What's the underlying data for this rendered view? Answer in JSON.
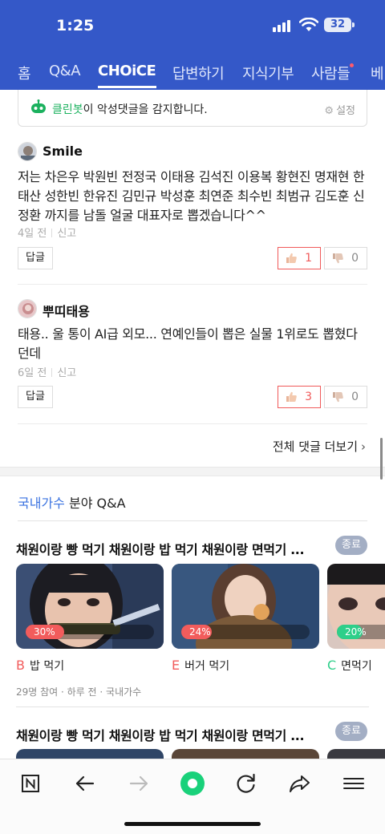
{
  "status_bar": {
    "time": "1:25",
    "battery": "32"
  },
  "nav": {
    "tabs": [
      {
        "label": "홈"
      },
      {
        "label": "Q&A"
      },
      {
        "label": "CHOiCE"
      },
      {
        "label": "답변하기"
      },
      {
        "label": "지식기부"
      },
      {
        "label": "사람들"
      },
      {
        "label": "베"
      }
    ],
    "active_tab": "CHOiCE"
  },
  "cleanbot": {
    "name": "클린봇",
    "message": "이 악성댓글을 감지합니다.",
    "settings_label": "설정"
  },
  "comments": [
    {
      "author": "Smile",
      "text": "저는 차은우 박원빈 전정국 이태용 김석진 이용복 황현진 명재현 한태산 성한빈 한유진 김민규 박성훈 최연준 최수빈 최범규 김도훈 신정환 까지를 남돌 얼굴 대표자로 뽑겠습니다^^",
      "time": "4일 전",
      "report": "신고",
      "reply_label": "답글",
      "likes": "1",
      "dislikes": "0"
    },
    {
      "author": "뿌띠태용",
      "text": "태용.. 울 통이 AI급 외모... 연예인들이 뽑은 실물 1위로도 뽑혔다던데",
      "time": "6일 전",
      "report": "신고",
      "reply_label": "답글",
      "likes": "3",
      "dislikes": "0"
    }
  ],
  "more_comments": "전체 댓글 더보기",
  "section": {
    "category": "국내가수",
    "suffix": " 분야 Q&A"
  },
  "qa_items": [
    {
      "title": "채원이랑 빵 먹기 채원이랑 밥 먹기 채원이랑 면먹기 ...",
      "status": "종료",
      "options": [
        {
          "letter": "B",
          "label": "밥 먹기",
          "percent": "30%",
          "fraction": 0.3,
          "color": "#f25c5c"
        },
        {
          "letter": "E",
          "label": "버거 먹기",
          "percent": "24%",
          "fraction": 0.24,
          "color": "#f25c5c"
        },
        {
          "letter": "C",
          "label": "면먹기",
          "percent": "20%",
          "fraction": 0.2,
          "color": "#2ecf8a"
        }
      ],
      "meta": "29명 참여 · 하루 전 · 국내가수"
    },
    {
      "title": "채원이랑 빵 먹기 채원이랑 밥 먹기 채원이랑 면먹기 ...",
      "status": "종료"
    }
  ],
  "toolbar": {
    "items": [
      "naver-home-icon",
      "back-icon",
      "forward-icon",
      "green-dot-icon",
      "refresh-icon",
      "share-icon",
      "menu-icon"
    ]
  }
}
